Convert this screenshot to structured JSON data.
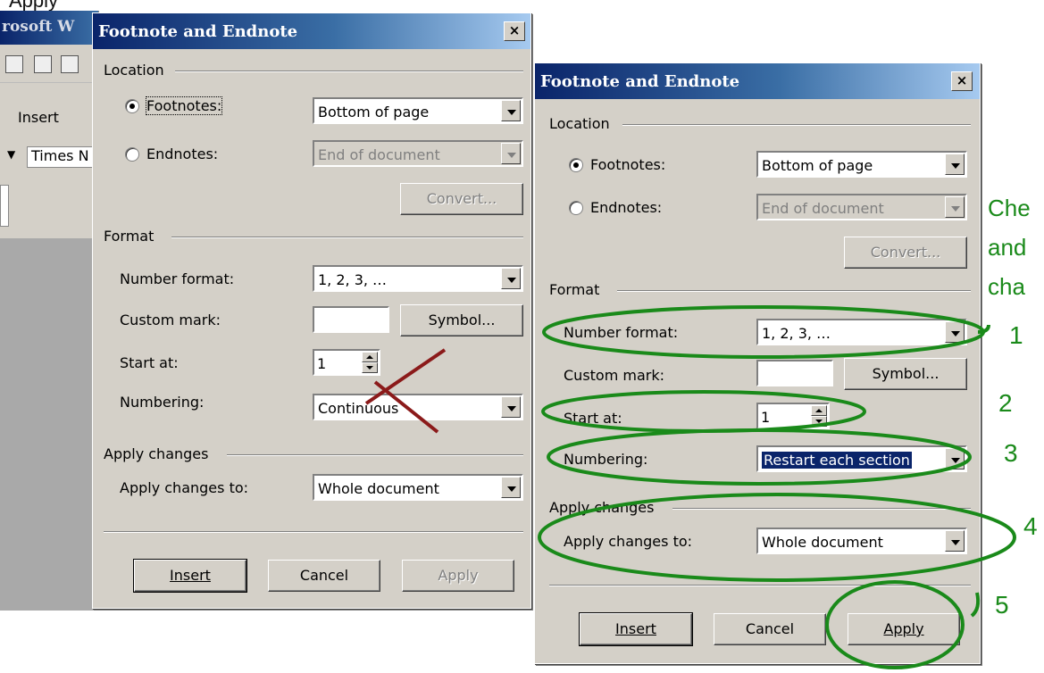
{
  "top_text": "Apply",
  "word_window": {
    "title": "rosoft W",
    "menu_insert": "Insert",
    "font_name": "Times N"
  },
  "left_dialog": {
    "title": "Footnote and Endnote",
    "close": "×",
    "location_label": "Location",
    "footnotes_label": "Footnotes:",
    "footnotes_value": "Bottom of page",
    "endnotes_label": "Endnotes:",
    "endnotes_value": "End of document",
    "convert_label": "Convert...",
    "format_label": "Format",
    "number_format_label": "Number format:",
    "number_format_value": "1, 2, 3, …",
    "custom_mark_label": "Custom mark:",
    "custom_mark_value": "",
    "symbol_label": "Symbol...",
    "start_at_label": "Start at:",
    "start_at_value": "1",
    "numbering_label": "Numbering:",
    "numbering_value": "Continuous",
    "apply_changes_label": "Apply changes",
    "apply_changes_to_label": "Apply changes to:",
    "apply_changes_to_value": "Whole document",
    "insert_label": "Insert",
    "cancel_label": "Cancel",
    "apply_label": "Apply"
  },
  "right_dialog": {
    "title": "Footnote and Endnote",
    "close": "×",
    "location_label": "Location",
    "footnotes_label": "Footnotes:",
    "footnotes_value": "Bottom of page",
    "endnotes_label": "Endnotes:",
    "endnotes_value": "End of document",
    "convert_label": "Convert...",
    "format_label": "Format",
    "number_format_label": "Number format:",
    "number_format_value": "1, 2, 3, …",
    "custom_mark_label": "Custom mark:",
    "custom_mark_value": "",
    "symbol_label": "Symbol...",
    "start_at_label": "Start at:",
    "start_at_value": "1",
    "numbering_label": "Numbering:",
    "numbering_value": "Restart each section",
    "apply_changes_label": "Apply changes",
    "apply_changes_to_label": "Apply changes to:",
    "apply_changes_to_value": "Whole document",
    "insert_label": "Insert",
    "cancel_label": "Cancel",
    "apply_label": "Apply"
  },
  "annotations": {
    "side_text_1": "Che",
    "side_text_2": "and",
    "side_text_3": "cha",
    "n1": "1",
    "n2": "2",
    "n3": "3",
    "n4": "4",
    "n5": "5",
    "color": "#1a8a1a",
    "cross_color": "#8b1a1a"
  }
}
